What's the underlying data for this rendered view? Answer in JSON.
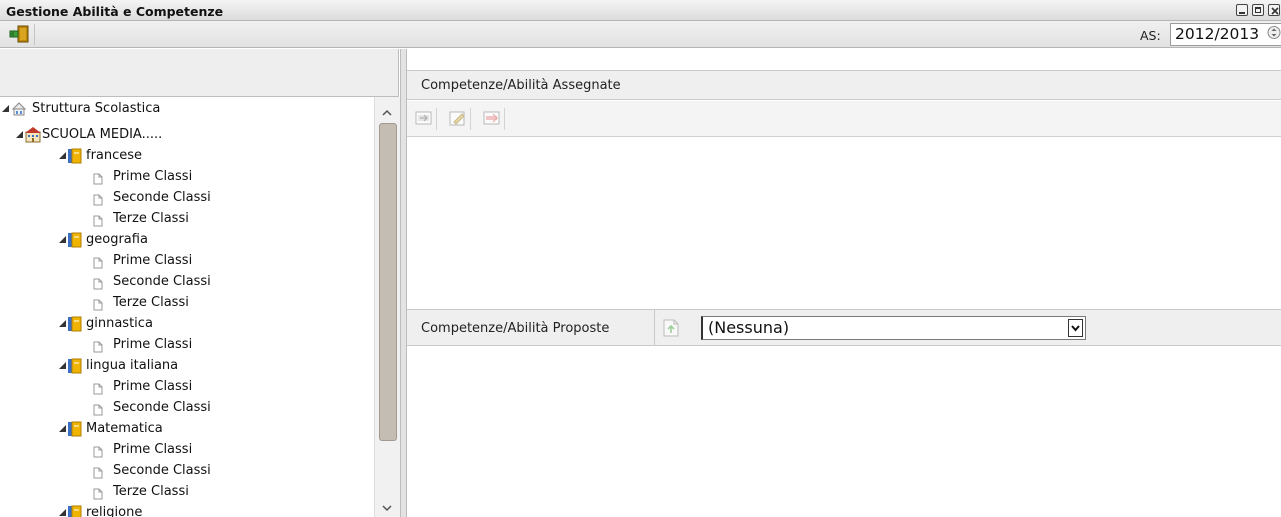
{
  "window": {
    "title": "Gestione Abilità e Competenze",
    "controls": [
      "minimize-icon",
      "maximize-icon",
      "close-icon"
    ]
  },
  "toolbar": {
    "exit_icon": "exit-door-icon",
    "as_label": "AS:",
    "as_value": "2012/2013"
  },
  "tree": {
    "nodes": [
      {
        "label": "Struttura Scolastica",
        "icon": "school-structure-icon",
        "expanded": true
      },
      {
        "label": "SCUOLA MEDIA.....",
        "icon": "school-building-icon",
        "expanded": true
      },
      {
        "label": "francese",
        "icon": "subject-book-icon",
        "expanded": true
      },
      {
        "label": "Prime Classi",
        "icon": "page-icon"
      },
      {
        "label": "Seconde Classi",
        "icon": "page-icon"
      },
      {
        "label": "Terze Classi",
        "icon": "page-icon"
      },
      {
        "label": "geografia",
        "icon": "subject-book-icon",
        "expanded": true
      },
      {
        "label": "Prime Classi",
        "icon": "page-icon"
      },
      {
        "label": "Seconde Classi",
        "icon": "page-icon"
      },
      {
        "label": "Terze Classi",
        "icon": "page-icon"
      },
      {
        "label": "ginnastica",
        "icon": "subject-book-icon",
        "expanded": true
      },
      {
        "label": "Prime Classi",
        "icon": "page-icon"
      },
      {
        "label": "lingua italiana",
        "icon": "subject-book-icon",
        "expanded": true
      },
      {
        "label": "Prime Classi",
        "icon": "page-icon"
      },
      {
        "label": "Seconde Classi",
        "icon": "page-icon"
      },
      {
        "label": "Matematica",
        "icon": "subject-book-icon",
        "expanded": true
      },
      {
        "label": "Prime Classi",
        "icon": "page-icon"
      },
      {
        "label": "Seconde Classi",
        "icon": "page-icon"
      },
      {
        "label": "Terze Classi",
        "icon": "page-icon"
      },
      {
        "label": "religione",
        "icon": "subject-book-icon",
        "expanded": true
      }
    ]
  },
  "assigned": {
    "title": "Competenze/Abilità Assegnate",
    "tools": [
      "add-icon",
      "edit-icon",
      "remove-icon"
    ]
  },
  "proposed": {
    "title": "Competenze/Abilità Proposte",
    "add_icon": "import-icon",
    "select_value": "(Nessuna)"
  },
  "colors": {
    "header_bg": "#efefef",
    "scroll_thumb": "#c3bdb4",
    "folder_blue": "#3a6fc4",
    "folder_yellow": "#f0b400"
  }
}
